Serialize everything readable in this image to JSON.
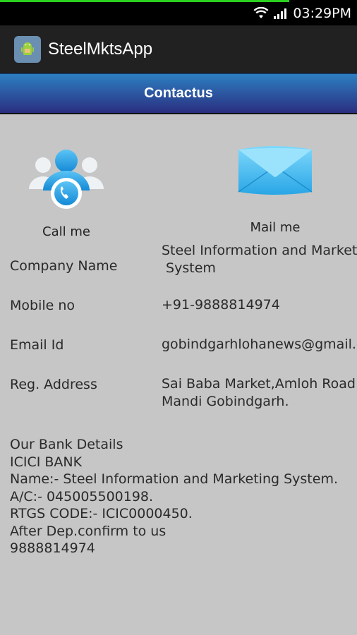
{
  "status_bar": {
    "time": "03:29PM",
    "icons": [
      "wifi-icon",
      "signal-icon"
    ]
  },
  "app": {
    "title": "SteelMktsApp",
    "icon": "android-icon"
  },
  "header": {
    "title": "Contactus"
  },
  "actions": {
    "call_label": "Call me",
    "mail_label": "Mail me"
  },
  "contact": {
    "company_label": "Company Name",
    "company_value": "Steel Information and Marketing\n System",
    "mobile_label": "Mobile no",
    "mobile_value": "+91-9888814974",
    "email_label": "Email Id",
    "email_value": "gobindgarhlohanews@gmail.com",
    "address_label": "Reg. Address",
    "address_value": "Sai Baba Market,Amloh Road\nMandi Gobindgarh."
  },
  "bank": {
    "lines": [
      "Our Bank Details",
      "ICICI BANK",
      "Name:- Steel Information and Marketing System.",
      "A/C:- 045005500198.",
      "RTGS CODE:- ICIC0000450.",
      "After Dep.confirm to us",
      "9888814974"
    ]
  },
  "colors": {
    "background": "#c6c6c6",
    "header_top": "#2d7fc1",
    "header_bottom": "#2a2f80",
    "action_bar": "#212121"
  }
}
